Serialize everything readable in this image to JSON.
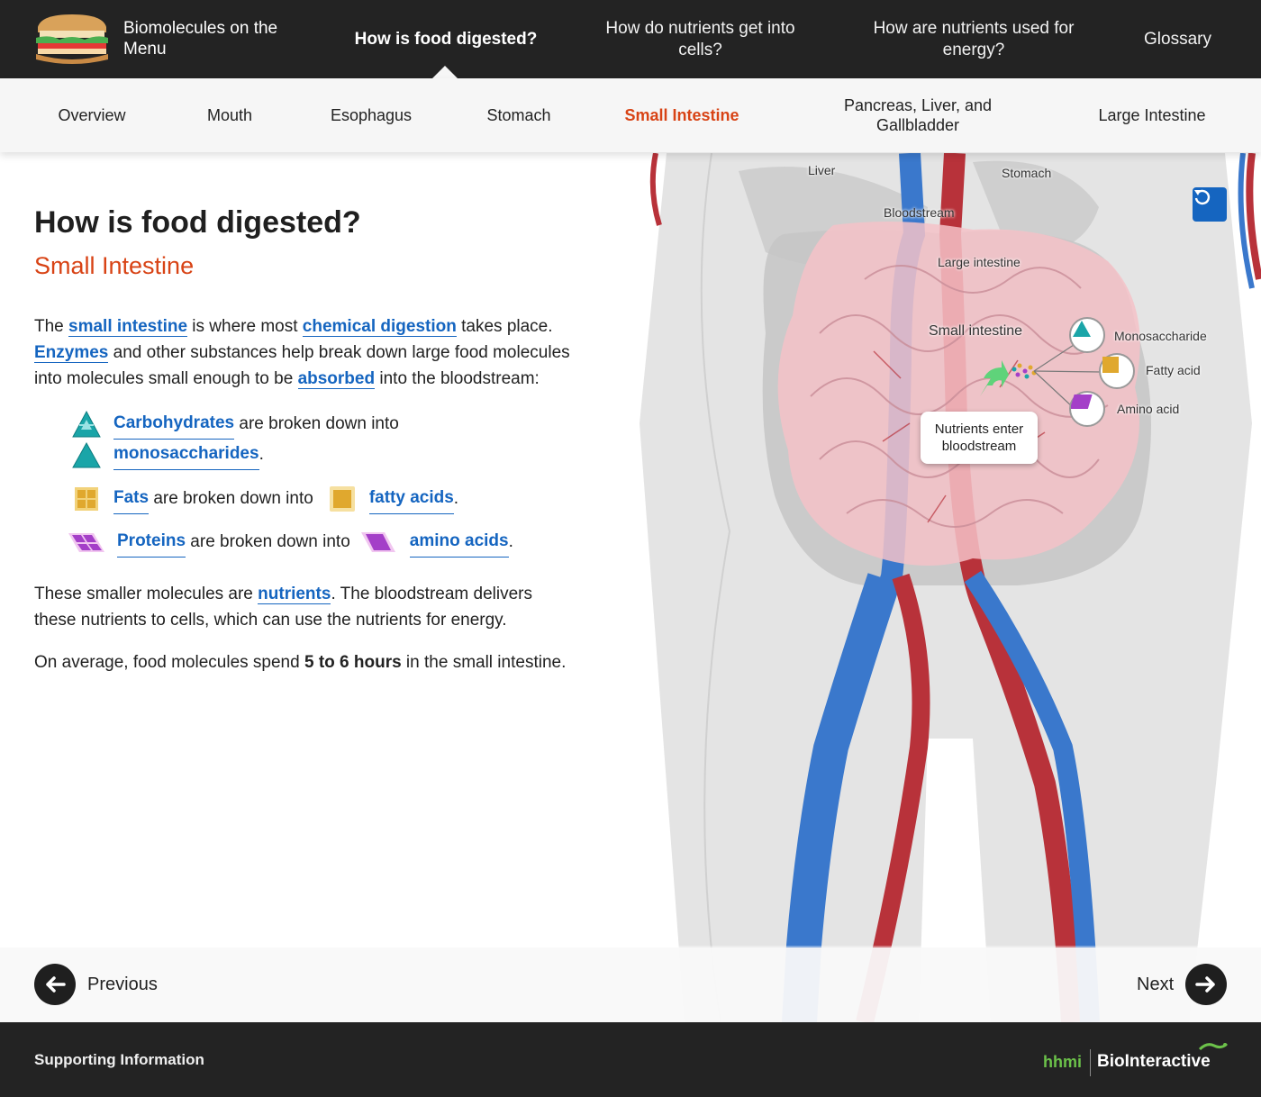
{
  "topnav": {
    "brand": "Biomolecules on the Menu",
    "items": [
      "How is food digested?",
      "How do nutrients get into cells?",
      "How are nutrients used for energy?",
      "Glossary"
    ]
  },
  "subnav": {
    "items": [
      "Overview",
      "Mouth",
      "Esophagus",
      "Stomach",
      "Small Intestine",
      "Pancreas, Liver, and Gallbladder",
      "Large Intestine"
    ]
  },
  "content": {
    "title": "How is food digested?",
    "subtitle": "Small Intestine",
    "p1": {
      "t1": "The ",
      "term1": "small intestine",
      "t2": " is where most ",
      "term2": "chemical digestion",
      "t3": " takes place.",
      "term3": "Enzymes",
      "t4": " and other substances help break down large food molecules into molecules small enough to be ",
      "term4": "absorbed",
      "t5": " into the bloodstream:"
    },
    "list": {
      "carb": "Carbohydrates",
      "carb_mid": " are broken down into",
      "mono": "monosaccharides",
      "dot": ".",
      "fats": "Fats",
      "fats_mid": " are broken down into",
      "fatty": "fatty acids",
      "prot": "Proteins",
      "prot_mid": " are broken down into",
      "amino": "amino acids"
    },
    "p2": {
      "t1": "These smaller molecules are ",
      "term": "nutrients",
      "t2": ". The bloodstream delivers these nutrients to cells, which can use the nutrients for energy."
    },
    "p3": {
      "t1": "On average, food molecules spend ",
      "bold": "5 to 6 hours",
      "t2": " in the small intestine."
    }
  },
  "diagram": {
    "labels": {
      "liver": "Liver",
      "stomach": "Stomach",
      "bloodstream": "Bloodstream",
      "large_intestine": "Large intestine",
      "small_intestine": "Small intestine",
      "monosaccharide": "Monosaccharide",
      "fatty_acid": "Fatty acid",
      "amino_acid": "Amino acid"
    },
    "bubble": "Nutrients enter bloodstream",
    "colors": {
      "artery": "#b8323a",
      "vein": "#3a78cc",
      "intestine": "#f5c4cc",
      "body": "#d9d9d9"
    }
  },
  "pager": {
    "previous": "Previous",
    "next": "Next"
  },
  "footer": {
    "support": "Supporting Information",
    "hhmi": "hhmi",
    "brand": "BioInteractive"
  },
  "colors": {
    "accent": "#d84315",
    "link": "#1565c0",
    "dark": "#232323"
  }
}
